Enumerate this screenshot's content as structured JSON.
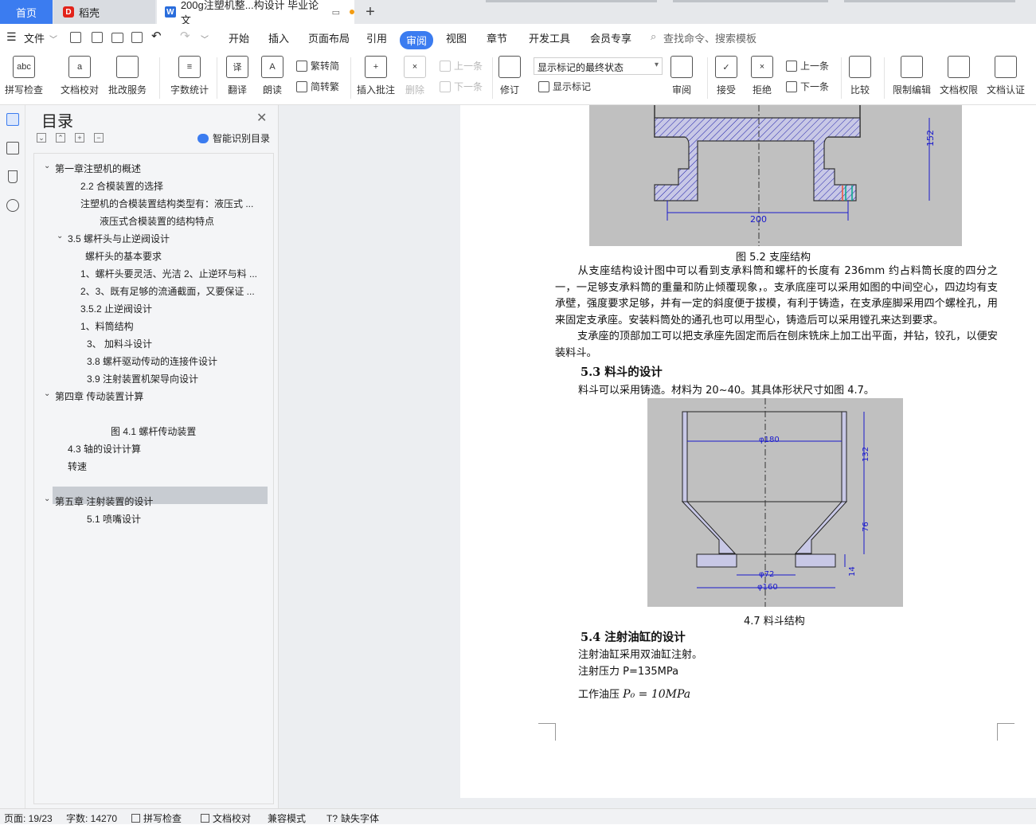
{
  "tabs": {
    "home": "首页",
    "daoke": "稻壳",
    "doc": "200g注塑机整...构设计 毕业论文",
    "add": "+"
  },
  "menu": {
    "file": "文件",
    "items": [
      "开始",
      "插入",
      "页面布局",
      "引用",
      "审阅",
      "视图",
      "章节",
      "开发工具",
      "会员专享"
    ],
    "search": "查找命令、搜索模板"
  },
  "ribbon": {
    "spell": "拼写检查",
    "proof": "文档校对",
    "correct": "批改服务",
    "wordcount": "字数统计",
    "translate": "翻译",
    "read": "朗读",
    "trad": "繁转简",
    "simp": "简转繁",
    "insert_comment": "插入批注",
    "delete": "删除",
    "prev_comment": "上一条",
    "next_comment": "下一条",
    "revise": "修订",
    "display_mode": "显示标记的最终状态",
    "show_marks": "显示标记",
    "review": "审阅",
    "accept": "接受",
    "reject": "拒绝",
    "prev": "上一条",
    "next": "下一条",
    "compare": "比较",
    "restrict": "限制编辑",
    "permission": "文档权限",
    "certify": "文档认证"
  },
  "toc": {
    "title": "目录",
    "ai": "智能识别目录",
    "items": [
      "第一章注塑机的概述",
      "2.2 合模装置的选择",
      "注塑机的合模装置结构类型有：液压式 ...",
      "液压式合模装置的结构特点",
      "3.5 螺杆头与止逆阀设计",
      "螺杆头的基本要求",
      "1、螺杆头要灵活、光洁 2、止逆环与料 ...",
      "2、3、既有足够的流通截面，又要保证 ...",
      "3.5.2 止逆阀设计",
      "1、料筒结构",
      "3、  加料斗设计",
      "3.8 螺杆驱动传动的连接件设计",
      "3.9 注射装置机架导向设计",
      "第四章   传动装置计算",
      "图 4.1  螺杆传动装置",
      "4.3 轴的设计计算",
      "转速",
      "第五章  注射装置的设计",
      "5.1  喷嘴设计"
    ]
  },
  "doc": {
    "fig52_caption": "图 5.2  支座结构",
    "fig52_dim_w": "200",
    "fig52_dim_h": "152",
    "para1": "从支座结构设计图中可以看到支承料筒和螺杆的长度有 236mm 约占料筒长度的四分之一，一足够支承料筒的重量和防止倾覆现象，。支承底座可以采用如图的中间空心，四边均有支承壁，强度要求足够，并有一定的斜度便于拔模，有利于铸造，在支承座脚采用四个螺栓孔，用来固定支承座。安装料筒处的通孔也可以用型心，铸造后可以采用镗孔来达到要求。",
    "para2": "支承座的顶部加工可以把支承座先固定而后在刨床铣床上加工出平面，并钻，铰孔，以便安装料斗。",
    "h53": "5.3     料斗的设计",
    "p53": "料斗可以采用铸造。材料为 20~40。其具体形状尺寸如图 4.7。",
    "fig47_caption": "4.7 料斗结构",
    "fig47_d180": "φ180",
    "fig47_d72": "φ72",
    "fig47_d160": "φ160",
    "fig47_h132": "132",
    "fig47_h76": "76",
    "fig47_h14": "14",
    "h54": "5.4     注射油缸的设计",
    "p54a": "注射油缸采用双油缸注射。",
    "p54b": "注射压力 P=135MPa",
    "p54c_label": "工作油压",
    "p54c_formula": "P₀ = 10MPa"
  },
  "status": {
    "page": "页面: 19/23",
    "words": "字数: 14270",
    "spell": "拼写检查",
    "proof": "文档校对",
    "compat": "兼容模式",
    "font": "缺失字体"
  }
}
